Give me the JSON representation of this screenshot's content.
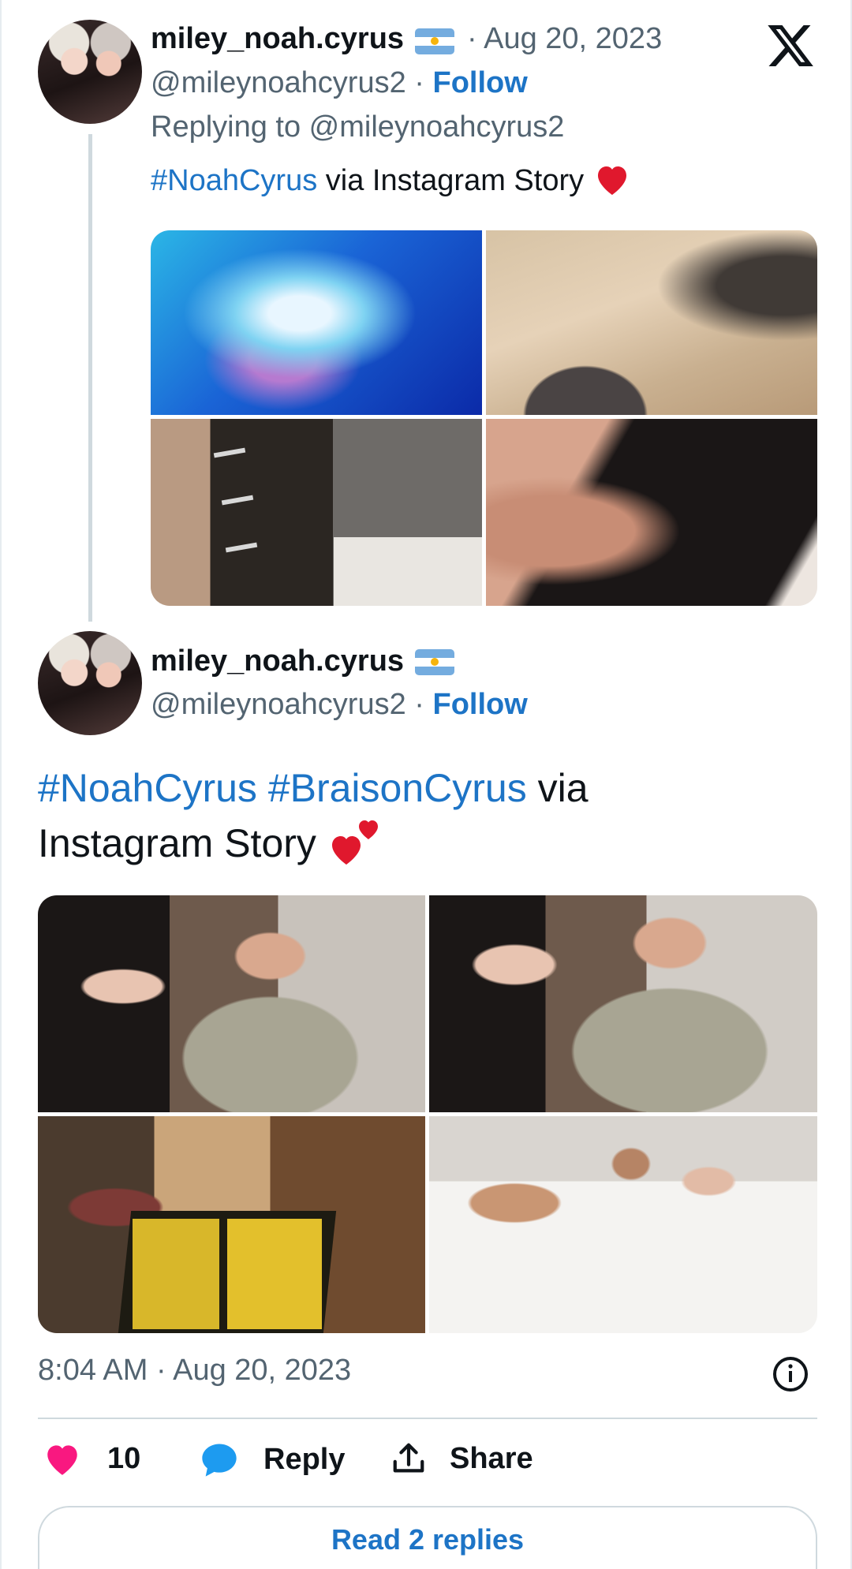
{
  "reply_tweet": {
    "display_name": "miley_noah.cyrus",
    "date": "· Aug 20, 2023",
    "handle": "@mileynoahcyrus2",
    "separator": "·",
    "follow_label": "Follow",
    "replying_to": "Replying to @mileynoahcyrus2",
    "hashtag": "#NoahCyrus",
    "text": "via Instagram Story",
    "images": [
      "blue-blurred-photo",
      "skin-closeup-photo",
      "hair-clips-photo",
      "black-hair-hand-photo"
    ]
  },
  "main_tweet": {
    "display_name": "miley_noah.cyrus",
    "handle": "@mileynoahcyrus2",
    "separator": "·",
    "follow_label": "Follow",
    "hashtag_1": "#NoahCyrus",
    "hashtag_2": "#BraisonCyrus",
    "text_1": "via",
    "text_2": "Instagram Story",
    "images": [
      "selfie-photo-1",
      "selfie-photo-2",
      "menu-photo",
      "bed-photo"
    ],
    "timestamp": "8:04 AM · Aug 20, 2023"
  },
  "actions": {
    "like_count": "10",
    "reply_label": "Reply",
    "share_label": "Share"
  },
  "read_replies_label": "Read 2 replies",
  "colors": {
    "link": "#1d74c6",
    "like": "#f91880",
    "reply": "#1d9bf0",
    "text": "#0f1419",
    "muted": "#536471"
  },
  "icons": [
    "x-logo-icon",
    "argentina-flag-icon",
    "red-heart-icon",
    "two-hearts-icon",
    "info-icon",
    "heart-icon",
    "speech-bubble-icon",
    "share-icon"
  ]
}
